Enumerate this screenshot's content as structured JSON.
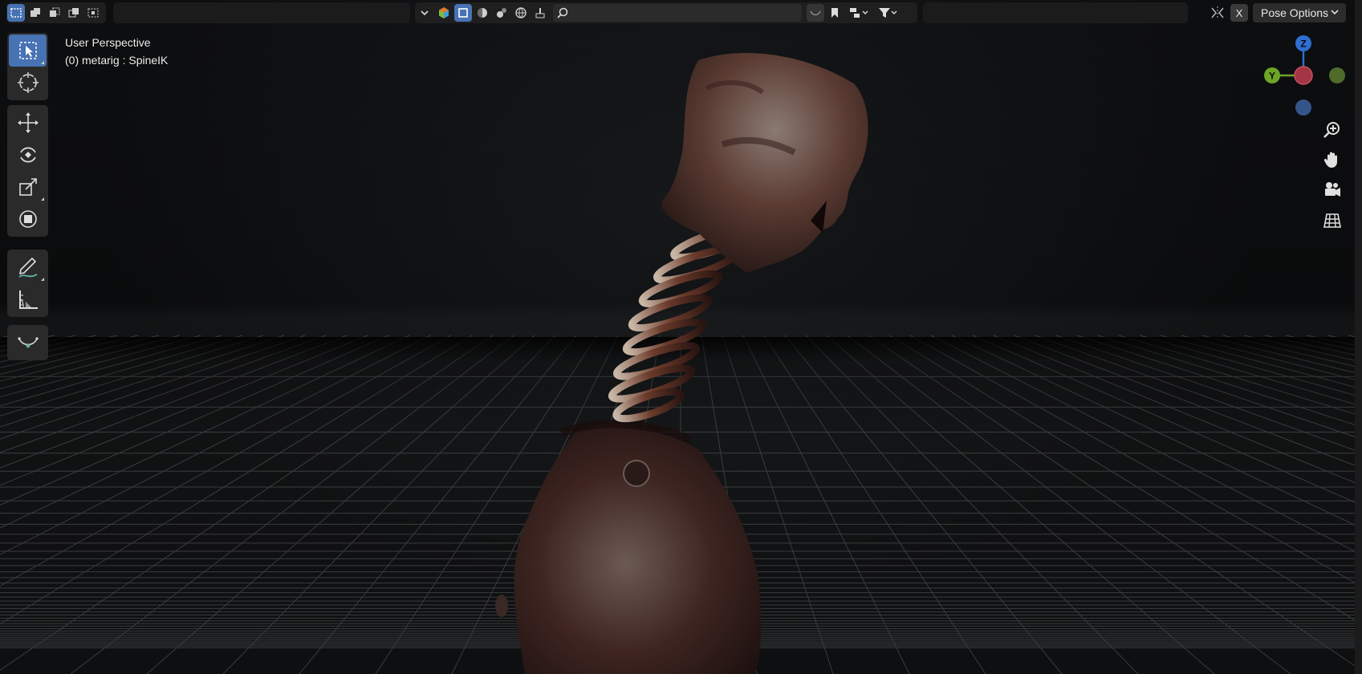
{
  "viewport": {
    "view_name": "User Perspective",
    "object_info": "(0) metarig : SpineIK"
  },
  "header": {
    "select_modes": [
      "select-box-icon",
      "extend-icon",
      "subtract-icon",
      "invert-icon",
      "intersect-icon"
    ],
    "shading_icons": [
      "wireframe-icon",
      "solid-icon",
      "material-preview-icon",
      "rendered-icon"
    ],
    "search_placeholder": "",
    "mirror_x_label": "X",
    "pose_options_label": "Pose Options"
  },
  "toolbar": {
    "tools": [
      {
        "name": "select-box",
        "active": true
      },
      {
        "name": "cursor",
        "active": false
      },
      {
        "name": "move",
        "active": false
      },
      {
        "name": "rotate",
        "active": false
      },
      {
        "name": "scale",
        "active": false
      },
      {
        "name": "transform",
        "active": false
      },
      {
        "name": "annotate",
        "active": false
      },
      {
        "name": "measure",
        "active": false
      },
      {
        "name": "bone-curve",
        "active": false
      }
    ]
  },
  "gizmo": {
    "axes": [
      {
        "label": "Z",
        "color": "#2f6fd1"
      },
      {
        "label": "Y",
        "color": "#6ea428"
      },
      {
        "label": "",
        "color": "#b83a4a"
      }
    ]
  },
  "colors": {
    "accent": "#4772b3",
    "background": "#0b0b0c",
    "grid": "#5b5f64"
  }
}
